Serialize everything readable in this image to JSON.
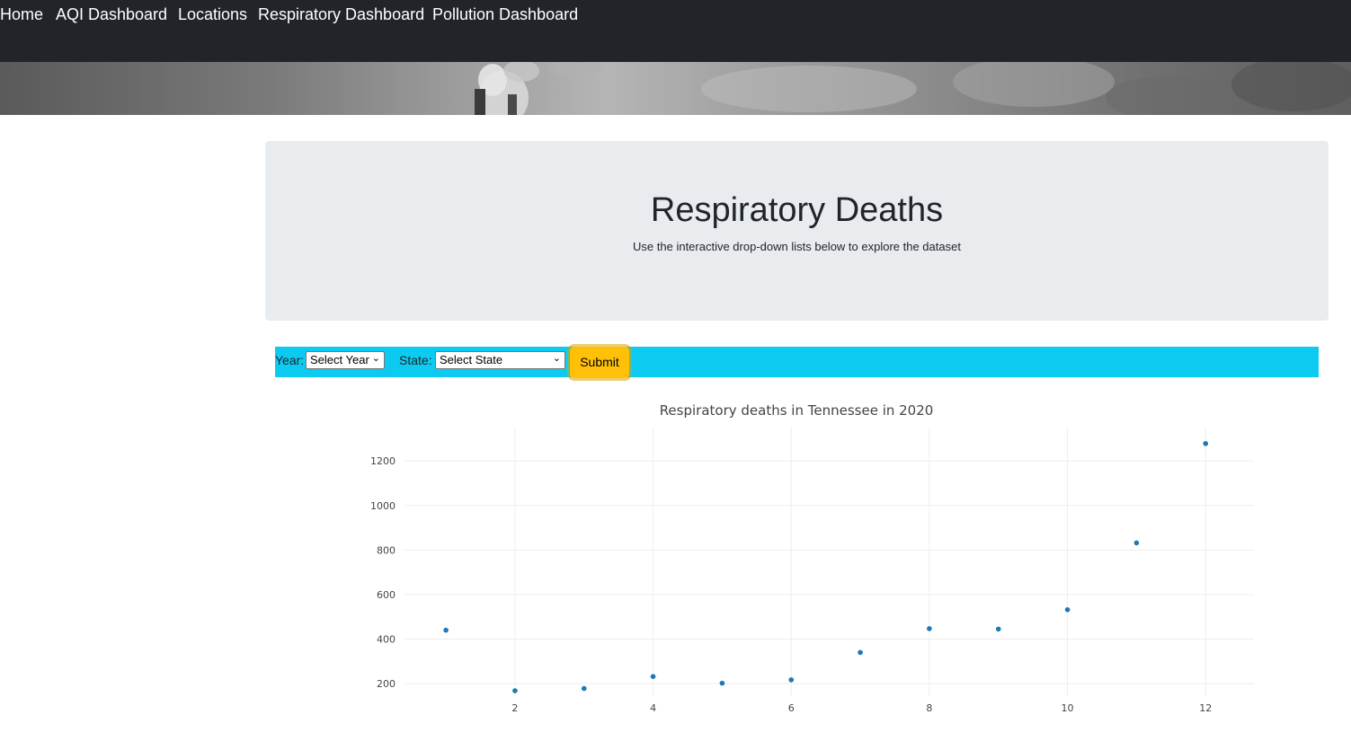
{
  "navbar": {
    "links": [
      {
        "label": "Home"
      },
      {
        "label": "AQI Dashboard"
      },
      {
        "label": "Locations"
      },
      {
        "label": "Respiratory Dashboard"
      },
      {
        "label": "Pollution Dashboard"
      }
    ],
    "background": "#212529"
  },
  "jumbotron": {
    "title": "Respiratory Deaths",
    "subtitle": "Use the interactive drop-down lists below to explore the dataset"
  },
  "filters": {
    "year_label": "Year:",
    "year_value": "Select Year",
    "state_label": "State:",
    "state_value": "Select State",
    "submit_label": "Submit",
    "bar_color": "#0dcaf0",
    "submit_color": "#ffc107"
  },
  "chart_data": {
    "type": "scatter",
    "title": "Respiratory deaths in Tennessee in 2020",
    "xlabel": "",
    "ylabel": "",
    "x": [
      1,
      2,
      3,
      4,
      5,
      6,
      7,
      8,
      9,
      10,
      11,
      12
    ],
    "y": [
      440,
      168,
      178,
      232,
      202,
      217,
      340,
      447,
      445,
      532,
      832,
      1278
    ],
    "x_ticks": [
      2,
      4,
      6,
      8,
      10,
      12
    ],
    "y_ticks": [
      200,
      400,
      600,
      800,
      1000,
      1200
    ],
    "xlim": [
      0.4,
      12.7
    ],
    "ylim": [
      140,
      1350
    ],
    "grid": true,
    "marker_color": "#1f77b4"
  }
}
